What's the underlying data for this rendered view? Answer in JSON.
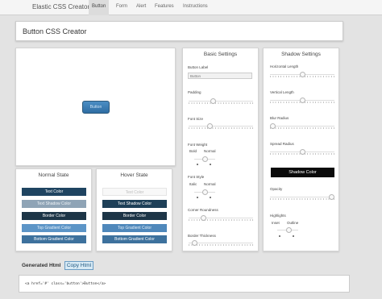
{
  "nav": {
    "brand": "Elastic CSS Creator",
    "items": [
      "Button",
      "Form",
      "Alert",
      "Features",
      "Instructions"
    ],
    "active": "Button"
  },
  "page_title": "Button CSS Creator",
  "preview": {
    "button_label": "Button"
  },
  "basic_settings": {
    "title": "Basic Settings",
    "button_label": {
      "label": "Button Label",
      "placeholder": "Button"
    },
    "padding": {
      "label": "Padding",
      "value_fraction": 0.37
    },
    "font_size": {
      "label": "Font Size",
      "value_fraction": 0.32
    },
    "font_weight": {
      "label": "Font Weight",
      "option_left": "Bold",
      "option_right": "Normal",
      "value_fraction": 0.55
    },
    "font_style": {
      "label": "Font Style",
      "option_left": "Italic",
      "option_right": "Normal",
      "value_fraction": 0.55
    },
    "corner_roundness": {
      "label": "Corner Roundness",
      "value_fraction": 0.2
    },
    "border_thickness": {
      "label": "Border Thickness",
      "value_fraction": 0.05
    }
  },
  "shadow_settings": {
    "title": "Shadow Settings",
    "horizontal_length": {
      "label": "Horizontal Length",
      "value_fraction": 0.5
    },
    "vertical_length": {
      "label": "Vertical Length",
      "value_fraction": 0.5
    },
    "blur_radius": {
      "label": "Blur Radius",
      "value_fraction": 0.0
    },
    "spread_radius": {
      "label": "Spread Radius",
      "value_fraction": 0.5
    },
    "shadow_color_label": "Shadow Color",
    "opacity": {
      "label": "Opacity",
      "value_fraction": 1.0
    },
    "highlights": {
      "label": "Highlights",
      "option_left": "Inset",
      "option_right": "Outline",
      "value_fraction": 0.6
    }
  },
  "normal_state": {
    "title": "Normal State",
    "buttons": [
      {
        "label": "Text Color",
        "bg": "#1f4461",
        "fg": "#ffffff"
      },
      {
        "label": "Text Shadow Color",
        "bg": "#8fa4b6",
        "fg": "#eef3f7"
      },
      {
        "label": "Border Color",
        "bg": "#1d3547",
        "fg": "#ffffff"
      },
      {
        "label": "Top Gradient Color",
        "bg": "#5c95c7",
        "fg": "#e6f1fa"
      },
      {
        "label": "Bottom Gradient Color",
        "bg": "#3d719d",
        "fg": "#ffffff"
      }
    ]
  },
  "hover_state": {
    "title": "Hover State",
    "buttons": [
      {
        "label": "Text Color",
        "bg": "#f8f8f8",
        "fg": "#bbbbbb"
      },
      {
        "label": "Text Shadow Color",
        "bg": "#1e4058",
        "fg": "#ffffff"
      },
      {
        "label": "Border Color",
        "bg": "#1d3547",
        "fg": "#ffffff"
      },
      {
        "label": "Top Gradient Color",
        "bg": "#4f88bb",
        "fg": "#e6f1fa"
      },
      {
        "label": "Bottom Gradient Color",
        "bg": "#3d719d",
        "fg": "#ffffff"
      }
    ]
  },
  "generated": {
    "label": "Generated Html",
    "copy_label": "Copy Html",
    "code": "<a href='#' class='button'>Button</a>"
  }
}
